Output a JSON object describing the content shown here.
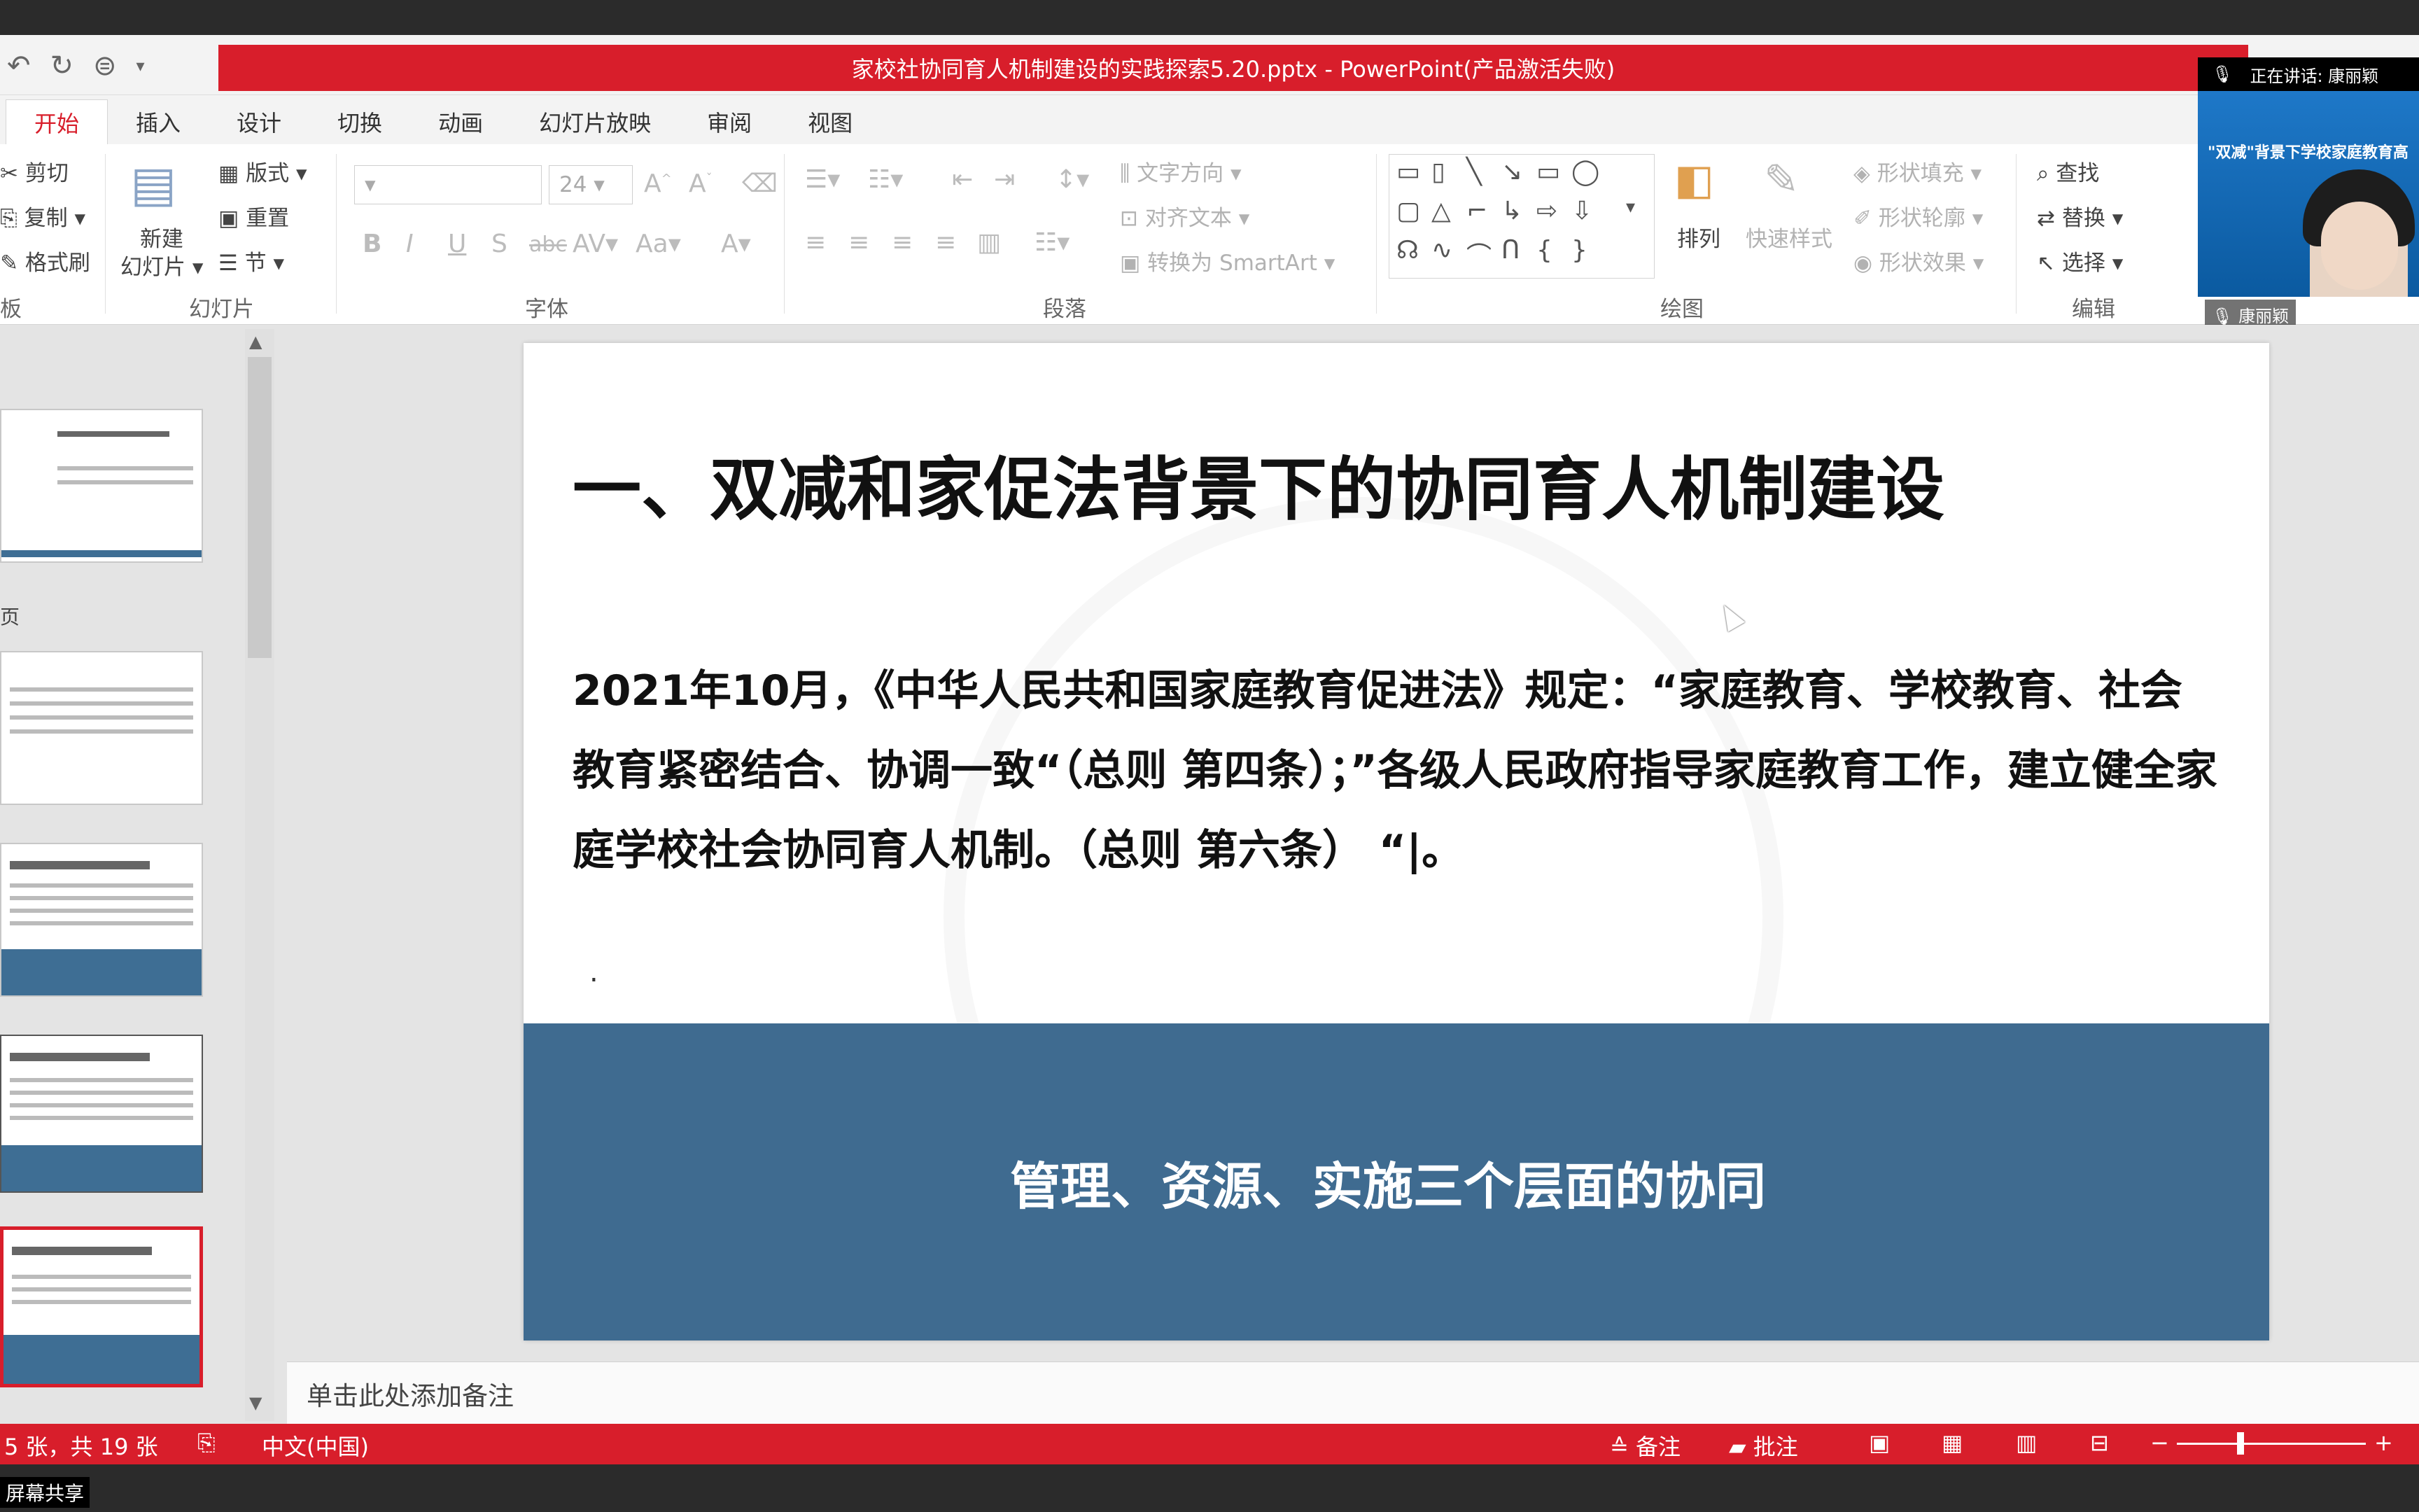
{
  "window": {
    "title": "家校社协同育人机制建设的实践探索5.20.pptx -  PowerPoint(产品激活失败)",
    "accent": "#d81e2b"
  },
  "tabs": [
    "开始",
    "插入",
    "设计",
    "切换",
    "动画",
    "幻灯片放映",
    "审阅",
    "视图"
  ],
  "ribbon": {
    "clipboard": {
      "cut": "剪切",
      "copy": "复制",
      "format_painter": "格式刷",
      "group_partial": "板"
    },
    "slides": {
      "new_slide_1": "新建",
      "new_slide_2": "幻灯片",
      "layout": "版式",
      "reset": "重置",
      "section": "节",
      "group": "幻灯片"
    },
    "font": {
      "size": "24",
      "group": "字体"
    },
    "paragraph": {
      "text_direction": "文字方向",
      "align_text": "对齐文本",
      "smartart": "转换为 SmartArt",
      "group": "段落"
    },
    "drawing": {
      "arrange": "排列",
      "quick_styles": "快速样式",
      "shape_fill": "形状填充",
      "shape_outline": "形状轮廓",
      "shape_effects": "形状效果",
      "group": "绘图"
    },
    "editing": {
      "find": "查找",
      "replace": "替换",
      "select": "选择",
      "group": "编辑"
    }
  },
  "webcam": {
    "speaking": "正在讲话: 康丽颖",
    "caption": "\"双减\"背景下学校家庭教育高",
    "name": "康丽颖"
  },
  "slide": {
    "title": "一、双减和家促法背景下的协同育人机制建设",
    "body": "2021年10月，《中华人民共和国家庭教育促进法》规定：“家庭教育、学校教育、社会教育紧密结合、协调一致“（总则  第四条）；”各级人民政府指导家庭教育工作，建立健全家庭学校社会协同育人机制。（总则  第六条）  “|。",
    "dot": ".",
    "banner": "管理、资源、实施三个层面的协同",
    "banner_color": "#3f6b90"
  },
  "notes_placeholder": "单击此处添加备注",
  "status": {
    "slide_counter": "5 张，共 19 张",
    "language": "中文(中国)",
    "notes": "备注",
    "comments": "批注"
  },
  "side_label": "页",
  "screen_share": "屏幕共享"
}
